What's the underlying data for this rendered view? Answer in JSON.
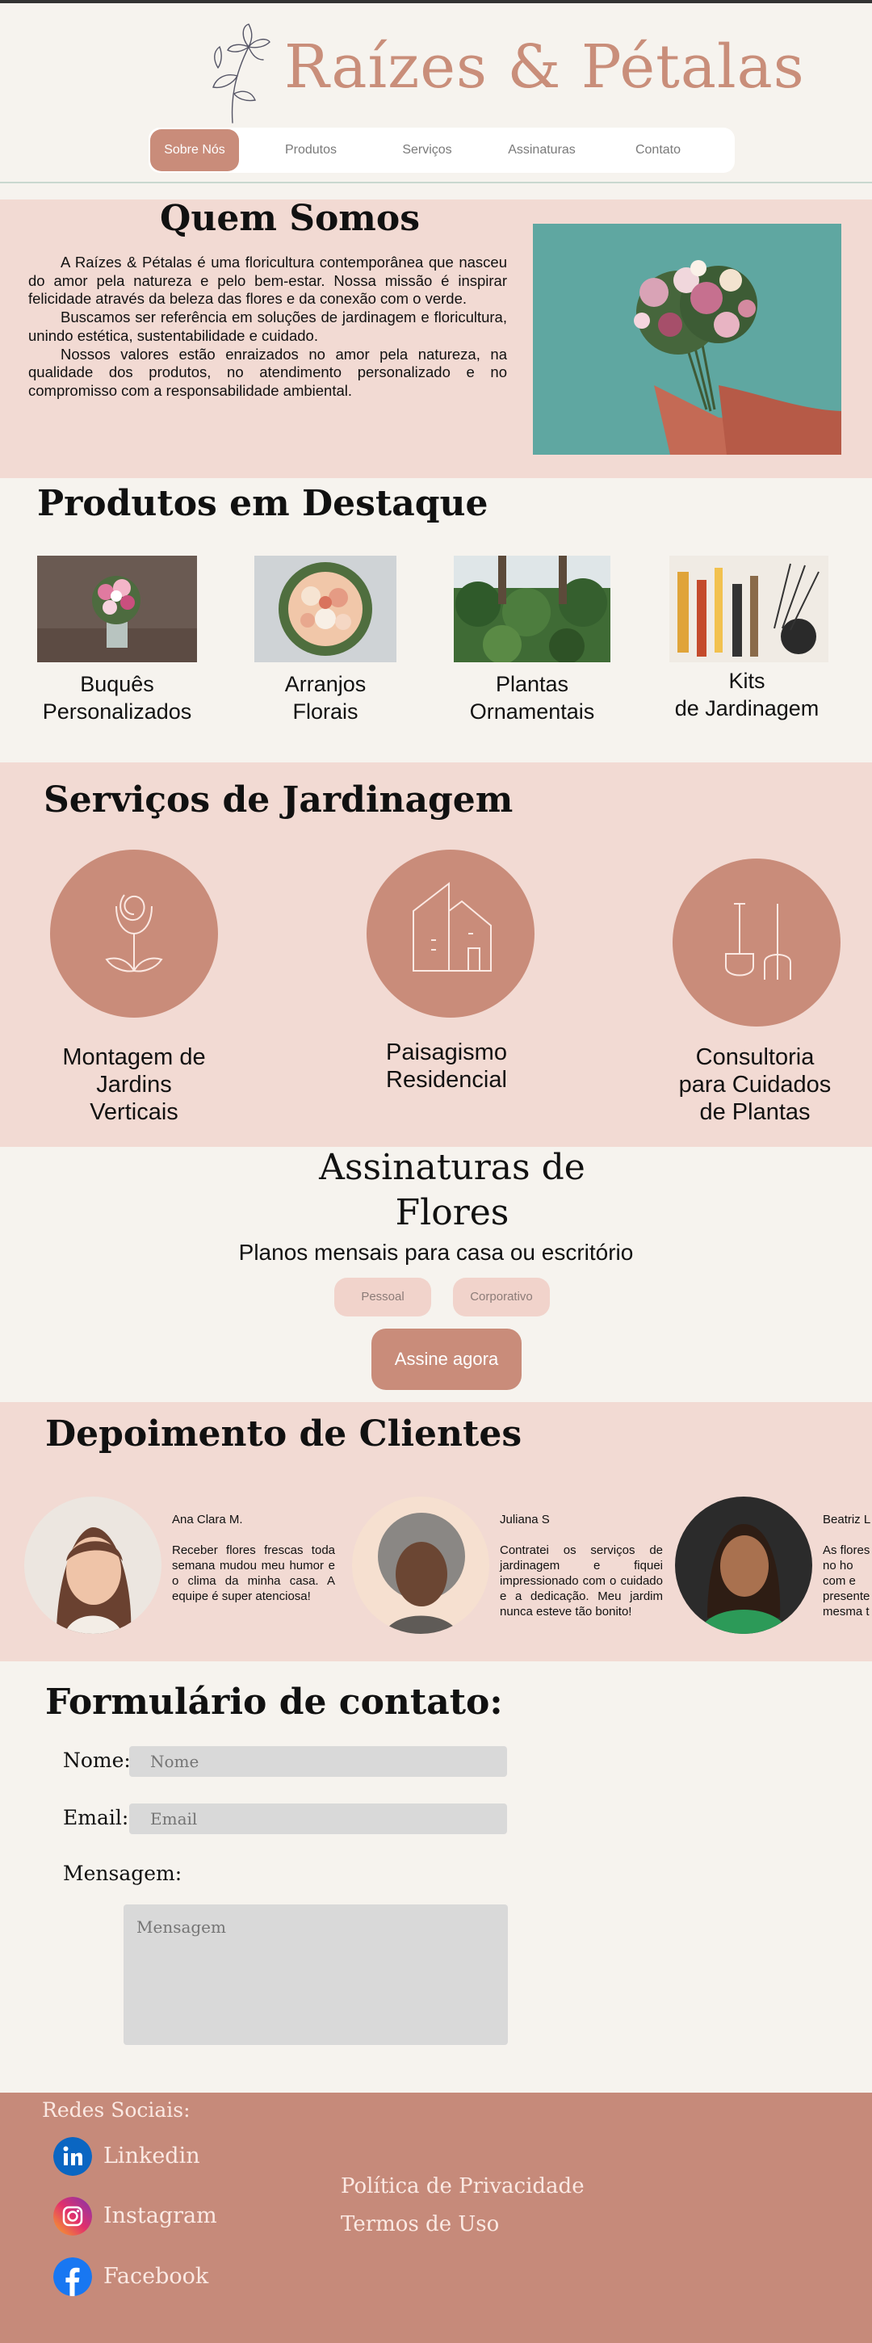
{
  "header": {
    "brand": "Raízes & Pétalas",
    "nav": [
      {
        "label": "Sobre Nós",
        "active": true
      },
      {
        "label": "Produtos",
        "active": false
      },
      {
        "label": "Serviços",
        "active": false
      },
      {
        "label": "Assinaturas",
        "active": false
      },
      {
        "label": "Contato",
        "active": false
      }
    ]
  },
  "about": {
    "title": "Quem Somos",
    "paragraphs": [
      "A Raízes & Pétalas é uma floricultura contemporânea que nasceu do amor pela natureza e pelo bem-estar. Nossa missão é inspirar felicidade através da beleza das flores e da conexão com o verde.",
      "Buscamos ser referência em soluções de jardinagem e floricultura, unindo estética, sustentabilidade e cuidado.",
      "Nossos valores estão enraizados no amor pela natureza, na qualidade dos produtos, no atendimento personalizado e no compromisso com a responsabilidade ambiental."
    ]
  },
  "products": {
    "title": "Produtos em Destaque",
    "items": [
      {
        "line1": "Buquês",
        "line2": "Personalizados"
      },
      {
        "line1": "Arranjos",
        "line2": "Florais"
      },
      {
        "line1": "Plantas",
        "line2": "Ornamentais"
      },
      {
        "line1": "Kits",
        "line2": "de Jardinagem"
      }
    ]
  },
  "services": {
    "title": "Serviços de Jardinagem",
    "items": [
      {
        "line1": "Montagem de",
        "line2": "Jardins",
        "line3": "Verticais",
        "icon": "flower-icon"
      },
      {
        "line1": "Paisagismo",
        "line2": "Residencial",
        "line3": "",
        "icon": "house-icon"
      },
      {
        "line1": "Consultoria",
        "line2": "para Cuidados",
        "line3": "de Plantas",
        "icon": "garden-tools-icon"
      }
    ]
  },
  "subscriptions": {
    "title_line1": "Assinaturas de",
    "title_line2": "Flores",
    "subtitle": "Planos mensais para casa ou escritório",
    "options": [
      "Pessoal",
      "Corporativo"
    ],
    "cta": "Assine agora"
  },
  "testimonials": {
    "title": "Depoimento de Clientes",
    "items": [
      {
        "name": "Ana Clara M.",
        "text": "Receber flores frescas toda semana mudou meu humor e o clima da minha casa. A equipe é super atenciosa!"
      },
      {
        "name": "Juliana S",
        "text": "Contratei os serviços de jardinagem e fiquei impressionado com o cuidado e a dedicação. Meu jardim nunca esteve tão bonito!"
      },
      {
        "name": "Beatriz L",
        "text": "As flores no ho com e presente mesma t"
      }
    ]
  },
  "contact": {
    "title": "Formulário de contato:",
    "name_label": "Nome:",
    "name_placeholder": "Nome",
    "email_label": "Email:",
    "email_placeholder": "Email",
    "message_label": "Mensagem:",
    "message_placeholder": "Mensagem"
  },
  "footer": {
    "social_title": "Redes Sociais:",
    "socials": [
      {
        "label": "Linkedin",
        "icon": "linkedin-icon"
      },
      {
        "label": "Instagram",
        "icon": "instagram-icon"
      },
      {
        "label": "Facebook",
        "icon": "facebook-icon"
      }
    ],
    "links": [
      "Política de Privacidade",
      "Termos de Uso"
    ]
  },
  "colors": {
    "accent": "#c98c7a",
    "band": "#f2dad3",
    "background": "#f6f3ee",
    "footer": "#c68a7a"
  }
}
